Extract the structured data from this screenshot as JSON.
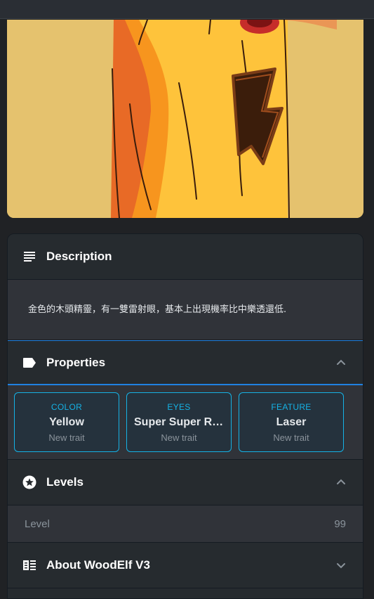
{
  "description": {
    "title": "Description",
    "text": "金色的木頭精靈，有一雙雷射眼，基本上出現機率比中樂透還低."
  },
  "properties": {
    "title": "Properties",
    "traits": [
      {
        "type": "COLOR",
        "value": "Yellow",
        "rarity": "New trait"
      },
      {
        "type": "EYES",
        "value": "Super Super Ra...",
        "rarity": "New trait"
      },
      {
        "type": "FEATURE",
        "value": "Laser",
        "rarity": "New trait"
      }
    ]
  },
  "levels": {
    "title": "Levels",
    "items": [
      {
        "name": "Level",
        "value": "99"
      }
    ]
  },
  "about": {
    "title": "About WoodElf V3"
  },
  "colors": {
    "background": "#202225",
    "panel": "#262b2f",
    "body": "#303339",
    "accent_blue": "#2081e2",
    "trait_cyan": "#15b2e5",
    "muted_text": "#8a939b"
  },
  "icons": {
    "description": "subject-lines-icon",
    "properties": "label-tag-icon",
    "levels": "star-circle-icon",
    "about": "list-detail-icon"
  }
}
